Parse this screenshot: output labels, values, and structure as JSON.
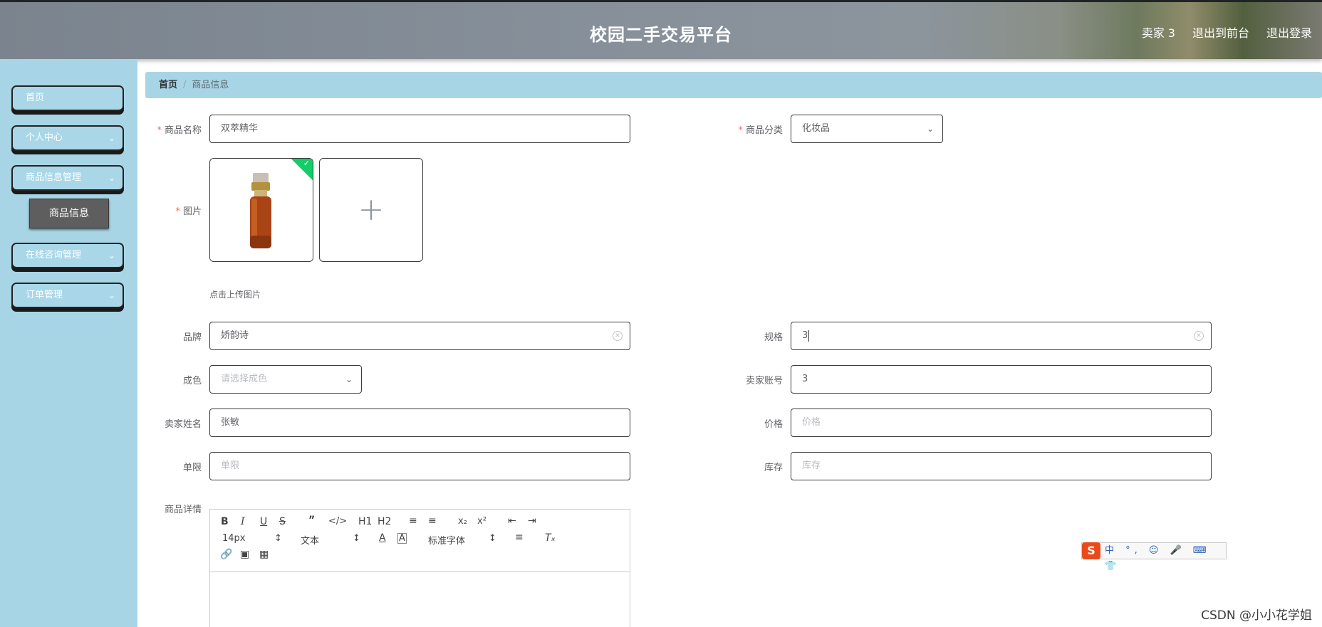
{
  "header": {
    "title": "校园二手交易平台",
    "user": "卖家 3",
    "to_front": "退出到前台",
    "logout": "退出登录"
  },
  "sidebar": {
    "items": [
      {
        "label": "首页"
      },
      {
        "label": "个人中心"
      },
      {
        "label": "商品信息管理"
      },
      {
        "label": "在线咨询管理"
      },
      {
        "label": "订单管理"
      }
    ],
    "sub_item": "商品信息"
  },
  "breadcrumb": {
    "home": "首页",
    "current": "商品信息"
  },
  "form": {
    "name": {
      "label": "商品名称",
      "value": "双萃精华"
    },
    "category": {
      "label": "商品分类",
      "value": "化妆品"
    },
    "image": {
      "label": "图片",
      "tip": "点击上传图片"
    },
    "brand": {
      "label": "品牌",
      "value": "娇韵诗"
    },
    "spec": {
      "label": "规格",
      "value": "3"
    },
    "condition": {
      "label": "成色",
      "placeholder": "请选择成色"
    },
    "seller_account": {
      "label": "卖家账号",
      "value": "3"
    },
    "seller_name": {
      "label": "卖家姓名",
      "value": "张敏"
    },
    "price": {
      "label": "价格",
      "placeholder": "价格"
    },
    "limit": {
      "label": "单限",
      "placeholder": "单限"
    },
    "stock": {
      "label": "库存",
      "placeholder": "库存"
    },
    "detail": {
      "label": "商品详情"
    }
  },
  "editor": {
    "font_size": "14px",
    "text_type": "文本",
    "font_family": "标准字体",
    "h1": "H1",
    "h2": "H2"
  },
  "ime": {
    "text": "中 °, ☺ 🎤 ⌨ 👕"
  },
  "watermark": "CSDN @小小花学姐"
}
